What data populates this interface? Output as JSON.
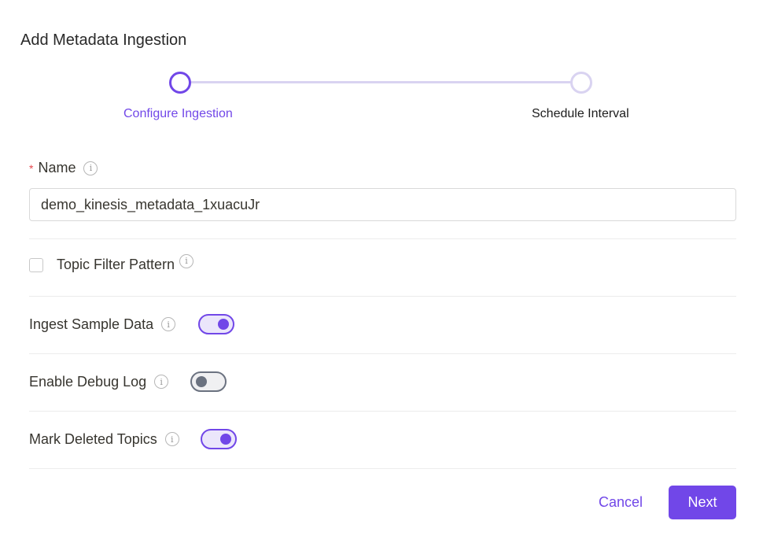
{
  "page": {
    "title": "Add Metadata Ingestion"
  },
  "stepper": {
    "steps": [
      {
        "label": "Configure Ingestion",
        "state": "active"
      },
      {
        "label": "Schedule Interval",
        "state": "inactive"
      }
    ],
    "active_color": "#7147e8",
    "inactive_color": "#d9d3f1"
  },
  "form": {
    "name": {
      "required_mark": "*",
      "label": "Name",
      "value": "demo_kinesis_metadata_1xuacuJr",
      "info_icon": "info-icon"
    },
    "topic_filter": {
      "label": "Topic Filter Pattern",
      "checked": false,
      "info_icon": "info-icon"
    },
    "toggles": [
      {
        "label": "Ingest Sample Data",
        "on": true,
        "info_icon": "info-icon"
      },
      {
        "label": "Enable Debug Log",
        "on": false,
        "info_icon": "info-icon"
      },
      {
        "label": "Mark Deleted Topics",
        "on": true,
        "info_icon": "info-icon"
      }
    ]
  },
  "actions": {
    "cancel_label": "Cancel",
    "next_label": "Next"
  },
  "colors": {
    "accent": "#7147e8",
    "required": "#e5484d",
    "toggle_off": "#6b7280"
  }
}
